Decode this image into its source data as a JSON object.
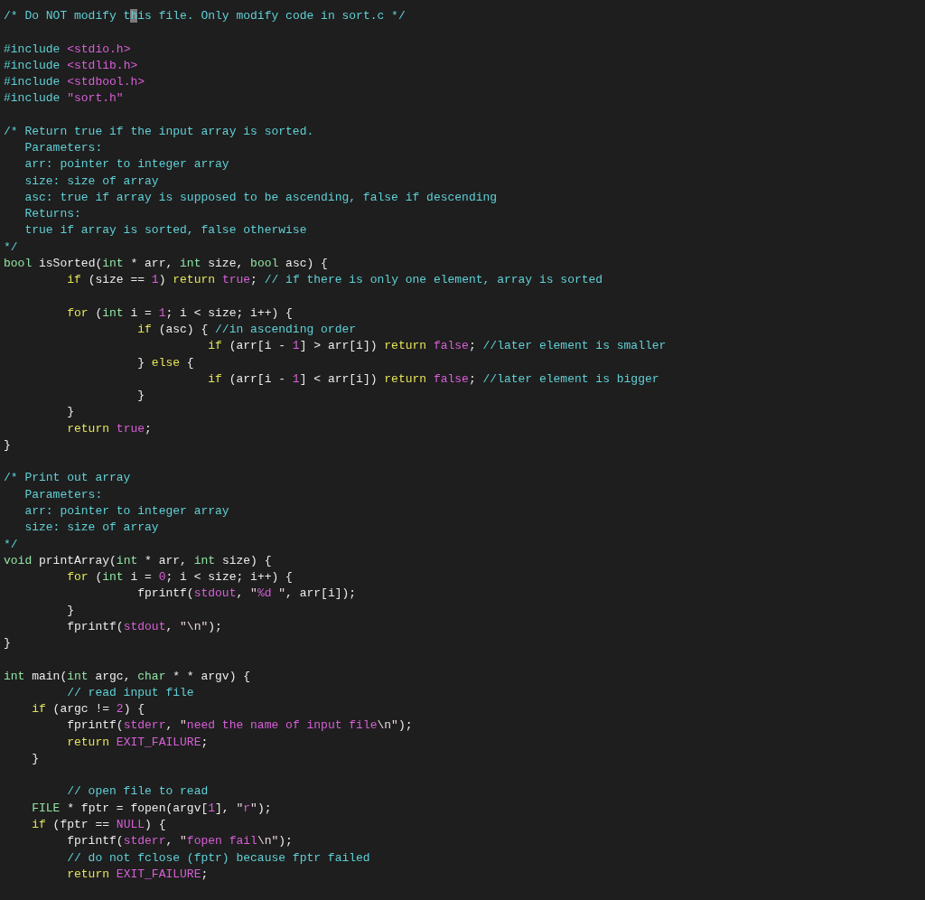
{
  "editor": {
    "lines": [
      {
        "kind": "code",
        "segments": [
          {
            "kind": "comment",
            "text": "/* Do NOT modify t"
          },
          {
            "kind": "cursor",
            "text": "h"
          },
          {
            "kind": "comment",
            "text": "is file. Only modify code in sort.c */"
          }
        ]
      },
      {
        "kind": "blank"
      },
      {
        "kind": "code",
        "segments": [
          {
            "kind": "preproc",
            "text": "#include "
          },
          {
            "kind": "string",
            "text": "<stdio.h>"
          }
        ]
      },
      {
        "kind": "code",
        "segments": [
          {
            "kind": "preproc",
            "text": "#include "
          },
          {
            "kind": "string",
            "text": "<stdlib.h>"
          }
        ]
      },
      {
        "kind": "code",
        "segments": [
          {
            "kind": "preproc",
            "text": "#include "
          },
          {
            "kind": "string",
            "text": "<stdbool.h>"
          }
        ]
      },
      {
        "kind": "code",
        "segments": [
          {
            "kind": "preproc",
            "text": "#include "
          },
          {
            "kind": "string",
            "text": "\"sort.h\""
          }
        ]
      },
      {
        "kind": "blank"
      },
      {
        "kind": "code",
        "segments": [
          {
            "kind": "comment",
            "text": "/* Return true if the input array is sorted."
          }
        ]
      },
      {
        "kind": "code",
        "segments": [
          {
            "kind": "comment",
            "text": "   Parameters:"
          }
        ]
      },
      {
        "kind": "code",
        "segments": [
          {
            "kind": "comment",
            "text": "   arr: pointer to integer array"
          }
        ]
      },
      {
        "kind": "code",
        "segments": [
          {
            "kind": "comment",
            "text": "   size: size of array"
          }
        ]
      },
      {
        "kind": "code",
        "segments": [
          {
            "kind": "comment",
            "text": "   asc: true if array is supposed to be ascending, false if descending"
          }
        ]
      },
      {
        "kind": "code",
        "segments": [
          {
            "kind": "comment",
            "text": "   Returns:"
          }
        ]
      },
      {
        "kind": "code",
        "segments": [
          {
            "kind": "comment",
            "text": "   true if array is sorted, false otherwise"
          }
        ]
      },
      {
        "kind": "code",
        "segments": [
          {
            "kind": "comment",
            "text": "*/"
          }
        ]
      },
      {
        "kind": "code",
        "segments": [
          {
            "kind": "type",
            "text": "bool"
          },
          {
            "kind": "plain",
            "text": " isSorted("
          },
          {
            "kind": "type",
            "text": "int"
          },
          {
            "kind": "plain",
            "text": " * arr, "
          },
          {
            "kind": "type",
            "text": "int"
          },
          {
            "kind": "plain",
            "text": " size, "
          },
          {
            "kind": "type",
            "text": "bool"
          },
          {
            "kind": "plain",
            "text": " asc) {"
          }
        ]
      },
      {
        "kind": "code",
        "segments": [
          {
            "kind": "keyword",
            "text": "         if"
          },
          {
            "kind": "plain",
            "text": " (size == "
          },
          {
            "kind": "constant",
            "text": "1"
          },
          {
            "kind": "plain",
            "text": ") "
          },
          {
            "kind": "keyword",
            "text": "return "
          },
          {
            "kind": "constant",
            "text": "true"
          },
          {
            "kind": "plain",
            "text": "; "
          },
          {
            "kind": "comment",
            "text": "// if there is only one element, array is sorted"
          }
        ]
      },
      {
        "kind": "blank"
      },
      {
        "kind": "code",
        "segments": [
          {
            "kind": "keyword",
            "text": "         for"
          },
          {
            "kind": "plain",
            "text": " ("
          },
          {
            "kind": "type",
            "text": "int"
          },
          {
            "kind": "plain",
            "text": " i = "
          },
          {
            "kind": "constant",
            "text": "1"
          },
          {
            "kind": "plain",
            "text": "; i < size; i++) {"
          }
        ]
      },
      {
        "kind": "code",
        "segments": [
          {
            "kind": "keyword",
            "text": "                   if"
          },
          {
            "kind": "plain",
            "text": " (asc) { "
          },
          {
            "kind": "comment",
            "text": "//in ascending order"
          }
        ]
      },
      {
        "kind": "code",
        "segments": [
          {
            "kind": "keyword",
            "text": "                             if"
          },
          {
            "kind": "plain",
            "text": " (arr[i - "
          },
          {
            "kind": "constant",
            "text": "1"
          },
          {
            "kind": "plain",
            "text": "] > arr[i]) "
          },
          {
            "kind": "keyword",
            "text": "return "
          },
          {
            "kind": "constant",
            "text": "false"
          },
          {
            "kind": "plain",
            "text": "; "
          },
          {
            "kind": "comment",
            "text": "//later element is smaller"
          }
        ]
      },
      {
        "kind": "code",
        "segments": [
          {
            "kind": "plain",
            "text": "                   } "
          },
          {
            "kind": "keyword",
            "text": "else"
          },
          {
            "kind": "plain",
            "text": " {"
          }
        ]
      },
      {
        "kind": "code",
        "segments": [
          {
            "kind": "keyword",
            "text": "                             if"
          },
          {
            "kind": "plain",
            "text": " (arr[i - "
          },
          {
            "kind": "constant",
            "text": "1"
          },
          {
            "kind": "plain",
            "text": "] < arr[i]) "
          },
          {
            "kind": "keyword",
            "text": "return "
          },
          {
            "kind": "constant",
            "text": "false"
          },
          {
            "kind": "plain",
            "text": "; "
          },
          {
            "kind": "comment",
            "text": "//later element is bigger"
          }
        ]
      },
      {
        "kind": "code",
        "segments": [
          {
            "kind": "plain",
            "text": "                   }"
          }
        ]
      },
      {
        "kind": "code",
        "segments": [
          {
            "kind": "plain",
            "text": "         }"
          }
        ]
      },
      {
        "kind": "code",
        "segments": [
          {
            "kind": "keyword",
            "text": "         return "
          },
          {
            "kind": "constant",
            "text": "true"
          },
          {
            "kind": "plain",
            "text": ";"
          }
        ]
      },
      {
        "kind": "code",
        "segments": [
          {
            "kind": "plain",
            "text": "}"
          }
        ]
      },
      {
        "kind": "blank"
      },
      {
        "kind": "code",
        "segments": [
          {
            "kind": "comment",
            "text": "/* Print out array"
          }
        ]
      },
      {
        "kind": "code",
        "segments": [
          {
            "kind": "comment",
            "text": "   Parameters:"
          }
        ]
      },
      {
        "kind": "code",
        "segments": [
          {
            "kind": "comment",
            "text": "   arr: pointer to integer array"
          }
        ]
      },
      {
        "kind": "code",
        "segments": [
          {
            "kind": "comment",
            "text": "   size: size of array"
          }
        ]
      },
      {
        "kind": "code",
        "segments": [
          {
            "kind": "comment",
            "text": "*/"
          }
        ]
      },
      {
        "kind": "code",
        "segments": [
          {
            "kind": "type",
            "text": "void"
          },
          {
            "kind": "plain",
            "text": " printArray("
          },
          {
            "kind": "type",
            "text": "int"
          },
          {
            "kind": "plain",
            "text": " * arr, "
          },
          {
            "kind": "type",
            "text": "int"
          },
          {
            "kind": "plain",
            "text": " size) {"
          }
        ]
      },
      {
        "kind": "code",
        "segments": [
          {
            "kind": "keyword",
            "text": "         for"
          },
          {
            "kind": "plain",
            "text": " ("
          },
          {
            "kind": "type",
            "text": "int"
          },
          {
            "kind": "plain",
            "text": " i = "
          },
          {
            "kind": "constant",
            "text": "0"
          },
          {
            "kind": "plain",
            "text": "; i < size; i++) {"
          }
        ]
      },
      {
        "kind": "code",
        "segments": [
          {
            "kind": "plain",
            "text": "                   fprintf("
          },
          {
            "kind": "constant",
            "text": "stdout"
          },
          {
            "kind": "plain",
            "text": ", "
          },
          {
            "kind": "special",
            "text": "\""
          },
          {
            "kind": "string",
            "text": "%d "
          },
          {
            "kind": "special",
            "text": "\""
          },
          {
            "kind": "plain",
            "text": ", arr[i]);"
          }
        ]
      },
      {
        "kind": "code",
        "segments": [
          {
            "kind": "plain",
            "text": "         }"
          }
        ]
      },
      {
        "kind": "code",
        "segments": [
          {
            "kind": "plain",
            "text": "         fprintf("
          },
          {
            "kind": "constant",
            "text": "stdout"
          },
          {
            "kind": "plain",
            "text": ", "
          },
          {
            "kind": "special",
            "text": "\"\\n\""
          },
          {
            "kind": "plain",
            "text": ");"
          }
        ]
      },
      {
        "kind": "code",
        "segments": [
          {
            "kind": "plain",
            "text": "}"
          }
        ]
      },
      {
        "kind": "blank"
      },
      {
        "kind": "code",
        "segments": [
          {
            "kind": "type",
            "text": "int"
          },
          {
            "kind": "plain",
            "text": " main("
          },
          {
            "kind": "type",
            "text": "int"
          },
          {
            "kind": "plain",
            "text": " argc, "
          },
          {
            "kind": "type",
            "text": "char"
          },
          {
            "kind": "plain",
            "text": " * * argv) {"
          }
        ]
      },
      {
        "kind": "code",
        "segments": [
          {
            "kind": "comment",
            "text": "         // read input file"
          }
        ]
      },
      {
        "kind": "code",
        "segments": [
          {
            "kind": "keyword",
            "text": "    if"
          },
          {
            "kind": "plain",
            "text": " (argc != "
          },
          {
            "kind": "constant",
            "text": "2"
          },
          {
            "kind": "plain",
            "text": ") {"
          }
        ]
      },
      {
        "kind": "code",
        "segments": [
          {
            "kind": "plain",
            "text": "         fprintf("
          },
          {
            "kind": "constant",
            "text": "stderr"
          },
          {
            "kind": "plain",
            "text": ", "
          },
          {
            "kind": "special",
            "text": "\""
          },
          {
            "kind": "string",
            "text": "need the name of input file"
          },
          {
            "kind": "special",
            "text": "\\n\""
          },
          {
            "kind": "plain",
            "text": ");"
          }
        ]
      },
      {
        "kind": "code",
        "segments": [
          {
            "kind": "keyword",
            "text": "         return "
          },
          {
            "kind": "constant",
            "text": "EXIT_FAILURE"
          },
          {
            "kind": "plain",
            "text": ";"
          }
        ]
      },
      {
        "kind": "code",
        "segments": [
          {
            "kind": "plain",
            "text": "    }"
          }
        ]
      },
      {
        "kind": "blank"
      },
      {
        "kind": "code",
        "segments": [
          {
            "kind": "comment",
            "text": "         // open file to read"
          }
        ]
      },
      {
        "kind": "code",
        "segments": [
          {
            "kind": "type",
            "text": "    FILE"
          },
          {
            "kind": "plain",
            "text": " * fptr = fopen(argv["
          },
          {
            "kind": "constant",
            "text": "1"
          },
          {
            "kind": "plain",
            "text": "], "
          },
          {
            "kind": "special",
            "text": "\""
          },
          {
            "kind": "string",
            "text": "r"
          },
          {
            "kind": "special",
            "text": "\""
          },
          {
            "kind": "plain",
            "text": ");"
          }
        ]
      },
      {
        "kind": "code",
        "segments": [
          {
            "kind": "keyword",
            "text": "    if"
          },
          {
            "kind": "plain",
            "text": " (fptr == "
          },
          {
            "kind": "constant",
            "text": "NULL"
          },
          {
            "kind": "plain",
            "text": ") {"
          }
        ]
      },
      {
        "kind": "code",
        "segments": [
          {
            "kind": "plain",
            "text": "         fprintf("
          },
          {
            "kind": "constant",
            "text": "stderr"
          },
          {
            "kind": "plain",
            "text": ", "
          },
          {
            "kind": "special",
            "text": "\""
          },
          {
            "kind": "string",
            "text": "fopen fail"
          },
          {
            "kind": "special",
            "text": "\\n\""
          },
          {
            "kind": "plain",
            "text": ");"
          }
        ]
      },
      {
        "kind": "code",
        "segments": [
          {
            "kind": "comment",
            "text": "         // do not fclose (fptr) because fptr failed"
          }
        ]
      },
      {
        "kind": "code",
        "segments": [
          {
            "kind": "keyword",
            "text": "         return "
          },
          {
            "kind": "constant",
            "text": "EXIT_FAILURE"
          },
          {
            "kind": "plain",
            "text": ";"
          }
        ]
      }
    ]
  }
}
